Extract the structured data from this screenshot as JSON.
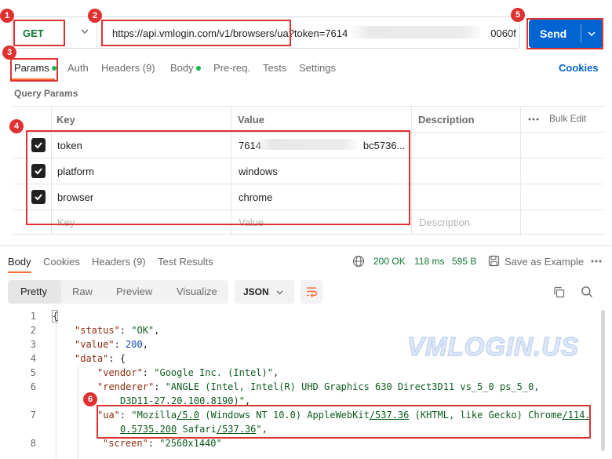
{
  "request": {
    "method": "GET",
    "url": "https://api.vmlogin.com/v1/browsers/ua?token=7614              0060f...",
    "send_label": "Send"
  },
  "request_tabs": {
    "params": "Params",
    "auth": "Auth",
    "headers": "Headers (9)",
    "body": "Body",
    "prereq": "Pre-req.",
    "tests": "Tests",
    "settings": "Settings",
    "cookies": "Cookies"
  },
  "query_params": {
    "title": "Query Params",
    "columns": {
      "key": "Key",
      "value": "Value",
      "description": "Description",
      "bulk_edit": "Bulk Edit"
    },
    "rows": [
      {
        "key": "token",
        "value": "7614          bc5736...",
        "checked": true
      },
      {
        "key": "platform",
        "value": "windows",
        "checked": true
      },
      {
        "key": "browser",
        "value": "chrome",
        "checked": true
      }
    ],
    "placeholder": {
      "key": "Key",
      "value": "Value",
      "description": "Description"
    }
  },
  "response_tabs": {
    "body": "Body",
    "cookies": "Cookies",
    "headers": "Headers (9)",
    "test_results": "Test Results"
  },
  "response_status": {
    "status": "200 OK",
    "time": "118 ms",
    "size": "595 B",
    "save_example": "Save as Example"
  },
  "viewer": {
    "modes": [
      "Pretty",
      "Raw",
      "Preview",
      "Visualize"
    ],
    "active_mode": "Pretty",
    "format": "JSON"
  },
  "code": {
    "line_numbers": [
      "1",
      "2",
      "3",
      "4",
      "5",
      "6",
      "7",
      "8"
    ],
    "brace_open": "{",
    "status_key": "\"status\"",
    "status_val": "\"OK\"",
    "value_key": "\"value\"",
    "value_val": "200",
    "data_key": "\"data\"",
    "data_open": "{",
    "vendor_key": "\"vendor\"",
    "vendor_val": "\"Google Inc. (Intel)\"",
    "renderer_key": "\"renderer\"",
    "renderer_val_1": "\"ANGLE (Intel, Intel(R) UHD Graphics 630 Direct3D11 vs_5_0 ps_5_0,",
    "renderer_val_2": "D3D11-27.20.100.8190)\"",
    "ua_key": "\"ua\"",
    "ua_1a": "\"Mozilla",
    "ua_1b": "/5.0",
    "ua_1c": " (Windows NT 10.0) AppleWebKit",
    "ua_1d": "/537.36",
    "ua_1e": " (KHTML, like Gecko) Chrome",
    "ua_1f": "/114.",
    "ua_2a": "0.5735.200",
    "ua_2b": " Safari",
    "ua_2c": "/537.36",
    "ua_2d": "\"",
    "screen_key": "\"screen\"",
    "screen_val": "\"2560x1440\""
  },
  "watermark": "VMLOGIN.US",
  "annotations": [
    "1",
    "2",
    "3",
    "4",
    "5",
    "6"
  ],
  "colors": {
    "accent_send": "#0265d2",
    "annotation_red": "#e03131",
    "active_tab": "#ff6c37",
    "status_green": "#0c7a34"
  }
}
